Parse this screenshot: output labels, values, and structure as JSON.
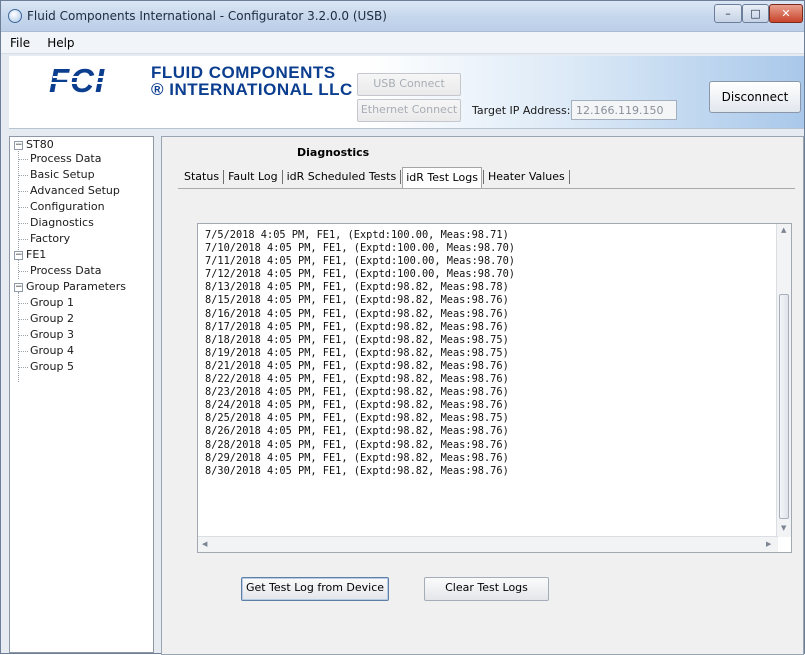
{
  "window": {
    "title": "Fluid Components International - Configurator 3.2.0.0 (USB)",
    "controls": {
      "minimize": "–",
      "maximize": "□",
      "close": "✕"
    }
  },
  "menu": {
    "items": [
      "File",
      "Help"
    ]
  },
  "header": {
    "logo_mark": "FCI",
    "logo_line1": "FLUID COMPONENTS",
    "logo_line2": "® INTERNATIONAL LLC",
    "usb_connect_label": "USB Connect",
    "ethernet_connect_label": "Ethernet Connect",
    "target_ip_label": "Target IP Address:",
    "target_ip_value": "12.166.119.150",
    "disconnect_label": "Disconnect"
  },
  "tree": {
    "nodes": {
      "st80": "ST80",
      "process_data_1": "Process Data",
      "basic_setup": "Basic Setup",
      "advanced_setup": "Advanced Setup",
      "configuration": "Configuration",
      "diagnostics": "Diagnostics",
      "factory": "Factory",
      "fe1": "FE1",
      "process_data_2": "Process Data",
      "group_parameters": "Group Parameters",
      "group1": "Group 1",
      "group2": "Group 2",
      "group3": "Group 3",
      "group4": "Group 4",
      "group5": "Group 5"
    },
    "expander_minus": "−"
  },
  "diagnostics": {
    "title": "Diagnostics",
    "tabs": [
      "Status",
      "Fault Log",
      "idR Scheduled Tests",
      "idR Test Logs",
      "Heater Values"
    ],
    "active_tab": "idR Test Logs",
    "log_text": "7/5/2018 4:05 PM, FE1, (Exptd:100.00, Meas:98.71)\n7/10/2018 4:05 PM, FE1, (Exptd:100.00, Meas:98.70)\n7/11/2018 4:05 PM, FE1, (Exptd:100.00, Meas:98.70)\n7/12/2018 4:05 PM, FE1, (Exptd:100.00, Meas:98.70)\n8/13/2018 4:05 PM, FE1, (Exptd:98.82, Meas:98.78)\n8/15/2018 4:05 PM, FE1, (Exptd:98.82, Meas:98.76)\n8/16/2018 4:05 PM, FE1, (Exptd:98.82, Meas:98.76)\n8/17/2018 4:05 PM, FE1, (Exptd:98.82, Meas:98.76)\n8/18/2018 4:05 PM, FE1, (Exptd:98.82, Meas:98.75)\n8/19/2018 4:05 PM, FE1, (Exptd:98.82, Meas:98.75)\n8/21/2018 4:05 PM, FE1, (Exptd:98.82, Meas:98.76)\n8/22/2018 4:05 PM, FE1, (Exptd:98.82, Meas:98.76)\n8/23/2018 4:05 PM, FE1, (Exptd:98.82, Meas:98.76)\n8/24/2018 4:05 PM, FE1, (Exptd:98.82, Meas:98.76)\n8/25/2018 4:05 PM, FE1, (Exptd:98.82, Meas:98.75)\n8/26/2018 4:05 PM, FE1, (Exptd:98.82, Meas:98.76)\n8/28/2018 4:05 PM, FE1, (Exptd:98.82, Meas:98.76)\n8/29/2018 4:05 PM, FE1, (Exptd:98.82, Meas:98.76)\n8/30/2018 4:05 PM, FE1, (Exptd:98.82, Meas:98.76)",
    "get_log_label": "Get Test Log from Device",
    "clear_log_label": "Clear Test Logs"
  },
  "colors": {
    "brand_blue": "#0c3e8f",
    "header_gradient_end": "#a9c8ea"
  }
}
